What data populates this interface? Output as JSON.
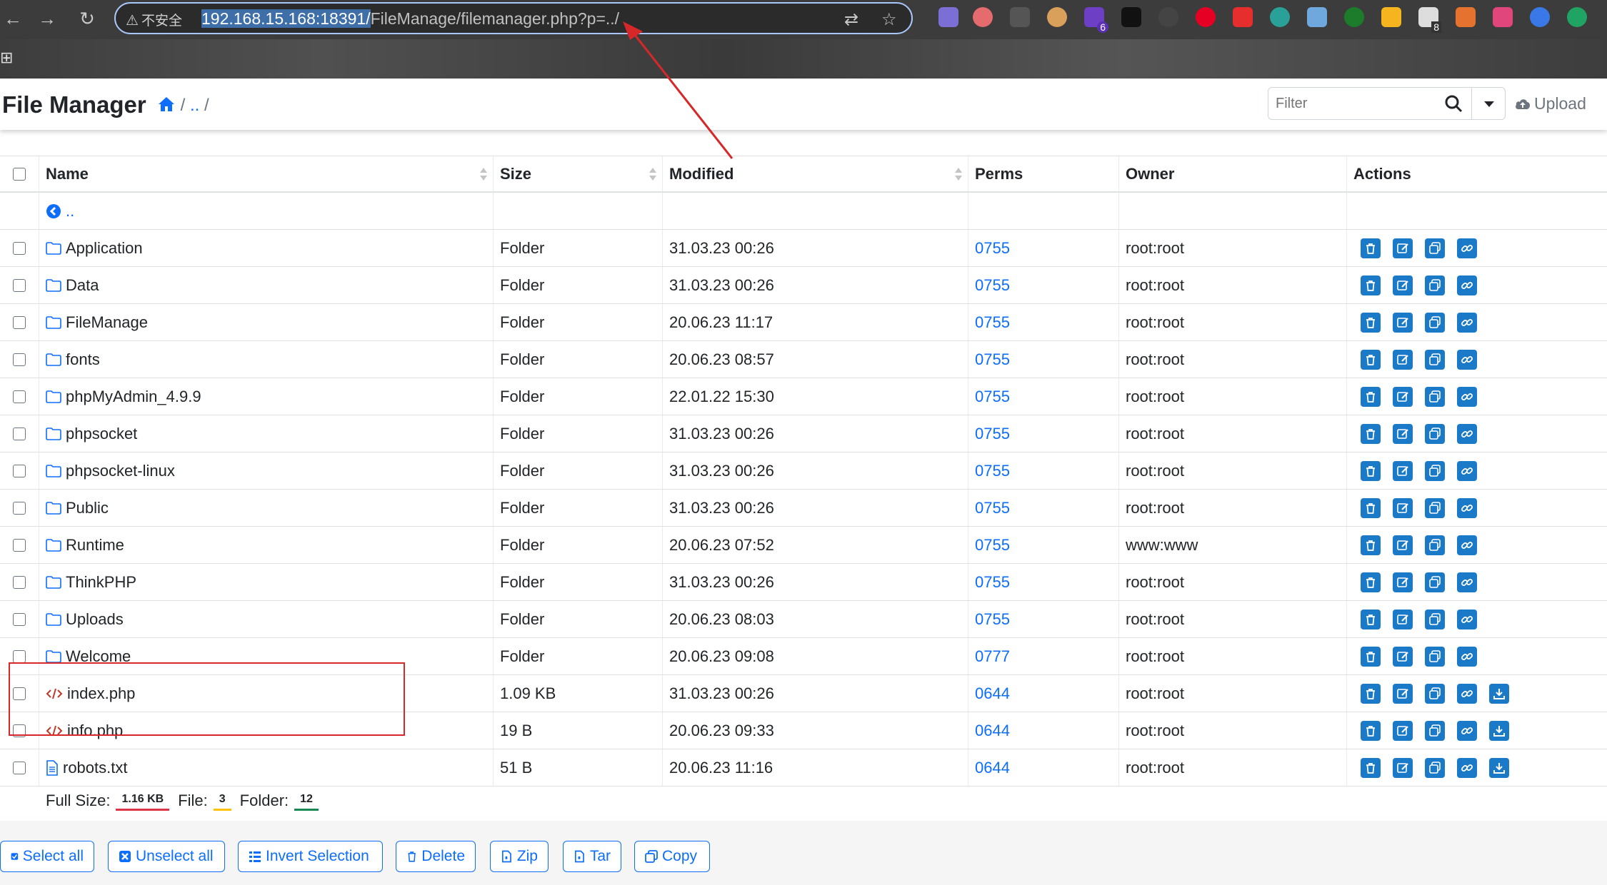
{
  "browser": {
    "security_label": "不安全",
    "url_host": "192.168.15.168:18391/",
    "url_path": "FileManage/filemanager.php?p=../",
    "extension_badges": [
      "6",
      "8"
    ]
  },
  "header": {
    "title": "File Manager",
    "breadcrumb_sep1": "/",
    "breadcrumb_parent": "..",
    "breadcrumb_sep2": "/",
    "filter_placeholder": "Filter",
    "upload_label": "Upload"
  },
  "table": {
    "columns": [
      "Name",
      "Size",
      "Modified",
      "Perms",
      "Owner",
      "Actions"
    ],
    "parent_link": "..",
    "rows": [
      {
        "name": "Application",
        "type": "folder",
        "size": "Folder",
        "modified": "31.03.23 00:26",
        "perms": "0755",
        "owner": "root:root"
      },
      {
        "name": "Data",
        "type": "folder",
        "size": "Folder",
        "modified": "31.03.23 00:26",
        "perms": "0755",
        "owner": "root:root"
      },
      {
        "name": "FileManage",
        "type": "folder",
        "size": "Folder",
        "modified": "20.06.23 11:17",
        "perms": "0755",
        "owner": "root:root"
      },
      {
        "name": "fonts",
        "type": "folder",
        "size": "Folder",
        "modified": "20.06.23 08:57",
        "perms": "0755",
        "owner": "root:root"
      },
      {
        "name": "phpMyAdmin_4.9.9",
        "type": "folder",
        "size": "Folder",
        "modified": "22.01.22 15:30",
        "perms": "0755",
        "owner": "root:root"
      },
      {
        "name": "phpsocket",
        "type": "folder",
        "size": "Folder",
        "modified": "31.03.23 00:26",
        "perms": "0755",
        "owner": "root:root"
      },
      {
        "name": "phpsocket-linux",
        "type": "folder",
        "size": "Folder",
        "modified": "31.03.23 00:26",
        "perms": "0755",
        "owner": "root:root"
      },
      {
        "name": "Public",
        "type": "folder",
        "size": "Folder",
        "modified": "31.03.23 00:26",
        "perms": "0755",
        "owner": "root:root"
      },
      {
        "name": "Runtime",
        "type": "folder",
        "size": "Folder",
        "modified": "20.06.23 07:52",
        "perms": "0755",
        "owner": "www:www"
      },
      {
        "name": "ThinkPHP",
        "type": "folder",
        "size": "Folder",
        "modified": "31.03.23 00:26",
        "perms": "0755",
        "owner": "root:root"
      },
      {
        "name": "Uploads",
        "type": "folder",
        "size": "Folder",
        "modified": "20.06.23 08:03",
        "perms": "0755",
        "owner": "root:root"
      },
      {
        "name": "Welcome",
        "type": "folder",
        "size": "Folder",
        "modified": "20.06.23 09:08",
        "perms": "0777",
        "owner": "root:root"
      },
      {
        "name": "index.php",
        "type": "code",
        "size": "1.09 KB",
        "modified": "31.03.23 00:26",
        "perms": "0644",
        "owner": "root:root"
      },
      {
        "name": "info.php",
        "type": "code",
        "size": "19 B",
        "modified": "20.06.23 09:33",
        "perms": "0644",
        "owner": "root:root"
      },
      {
        "name": "robots.txt",
        "type": "text",
        "size": "51 B",
        "modified": "20.06.23 11:16",
        "perms": "0644",
        "owner": "root:root"
      }
    ]
  },
  "summary": {
    "full_size_label": "Full Size:",
    "full_size": "1.16 KB",
    "file_label": "File:",
    "file_count": "3",
    "folder_label": "Folder:",
    "folder_count": "12"
  },
  "footer": {
    "select_all": "Select all",
    "unselect_all": "Unselect all",
    "invert_selection": "Invert Selection",
    "delete": "Delete",
    "zip": "Zip",
    "tar": "Tar",
    "copy": "Copy"
  },
  "colors": {
    "accent": "#0d6efd",
    "action_button": "#1a7ac8",
    "annotation": "#d62828"
  }
}
